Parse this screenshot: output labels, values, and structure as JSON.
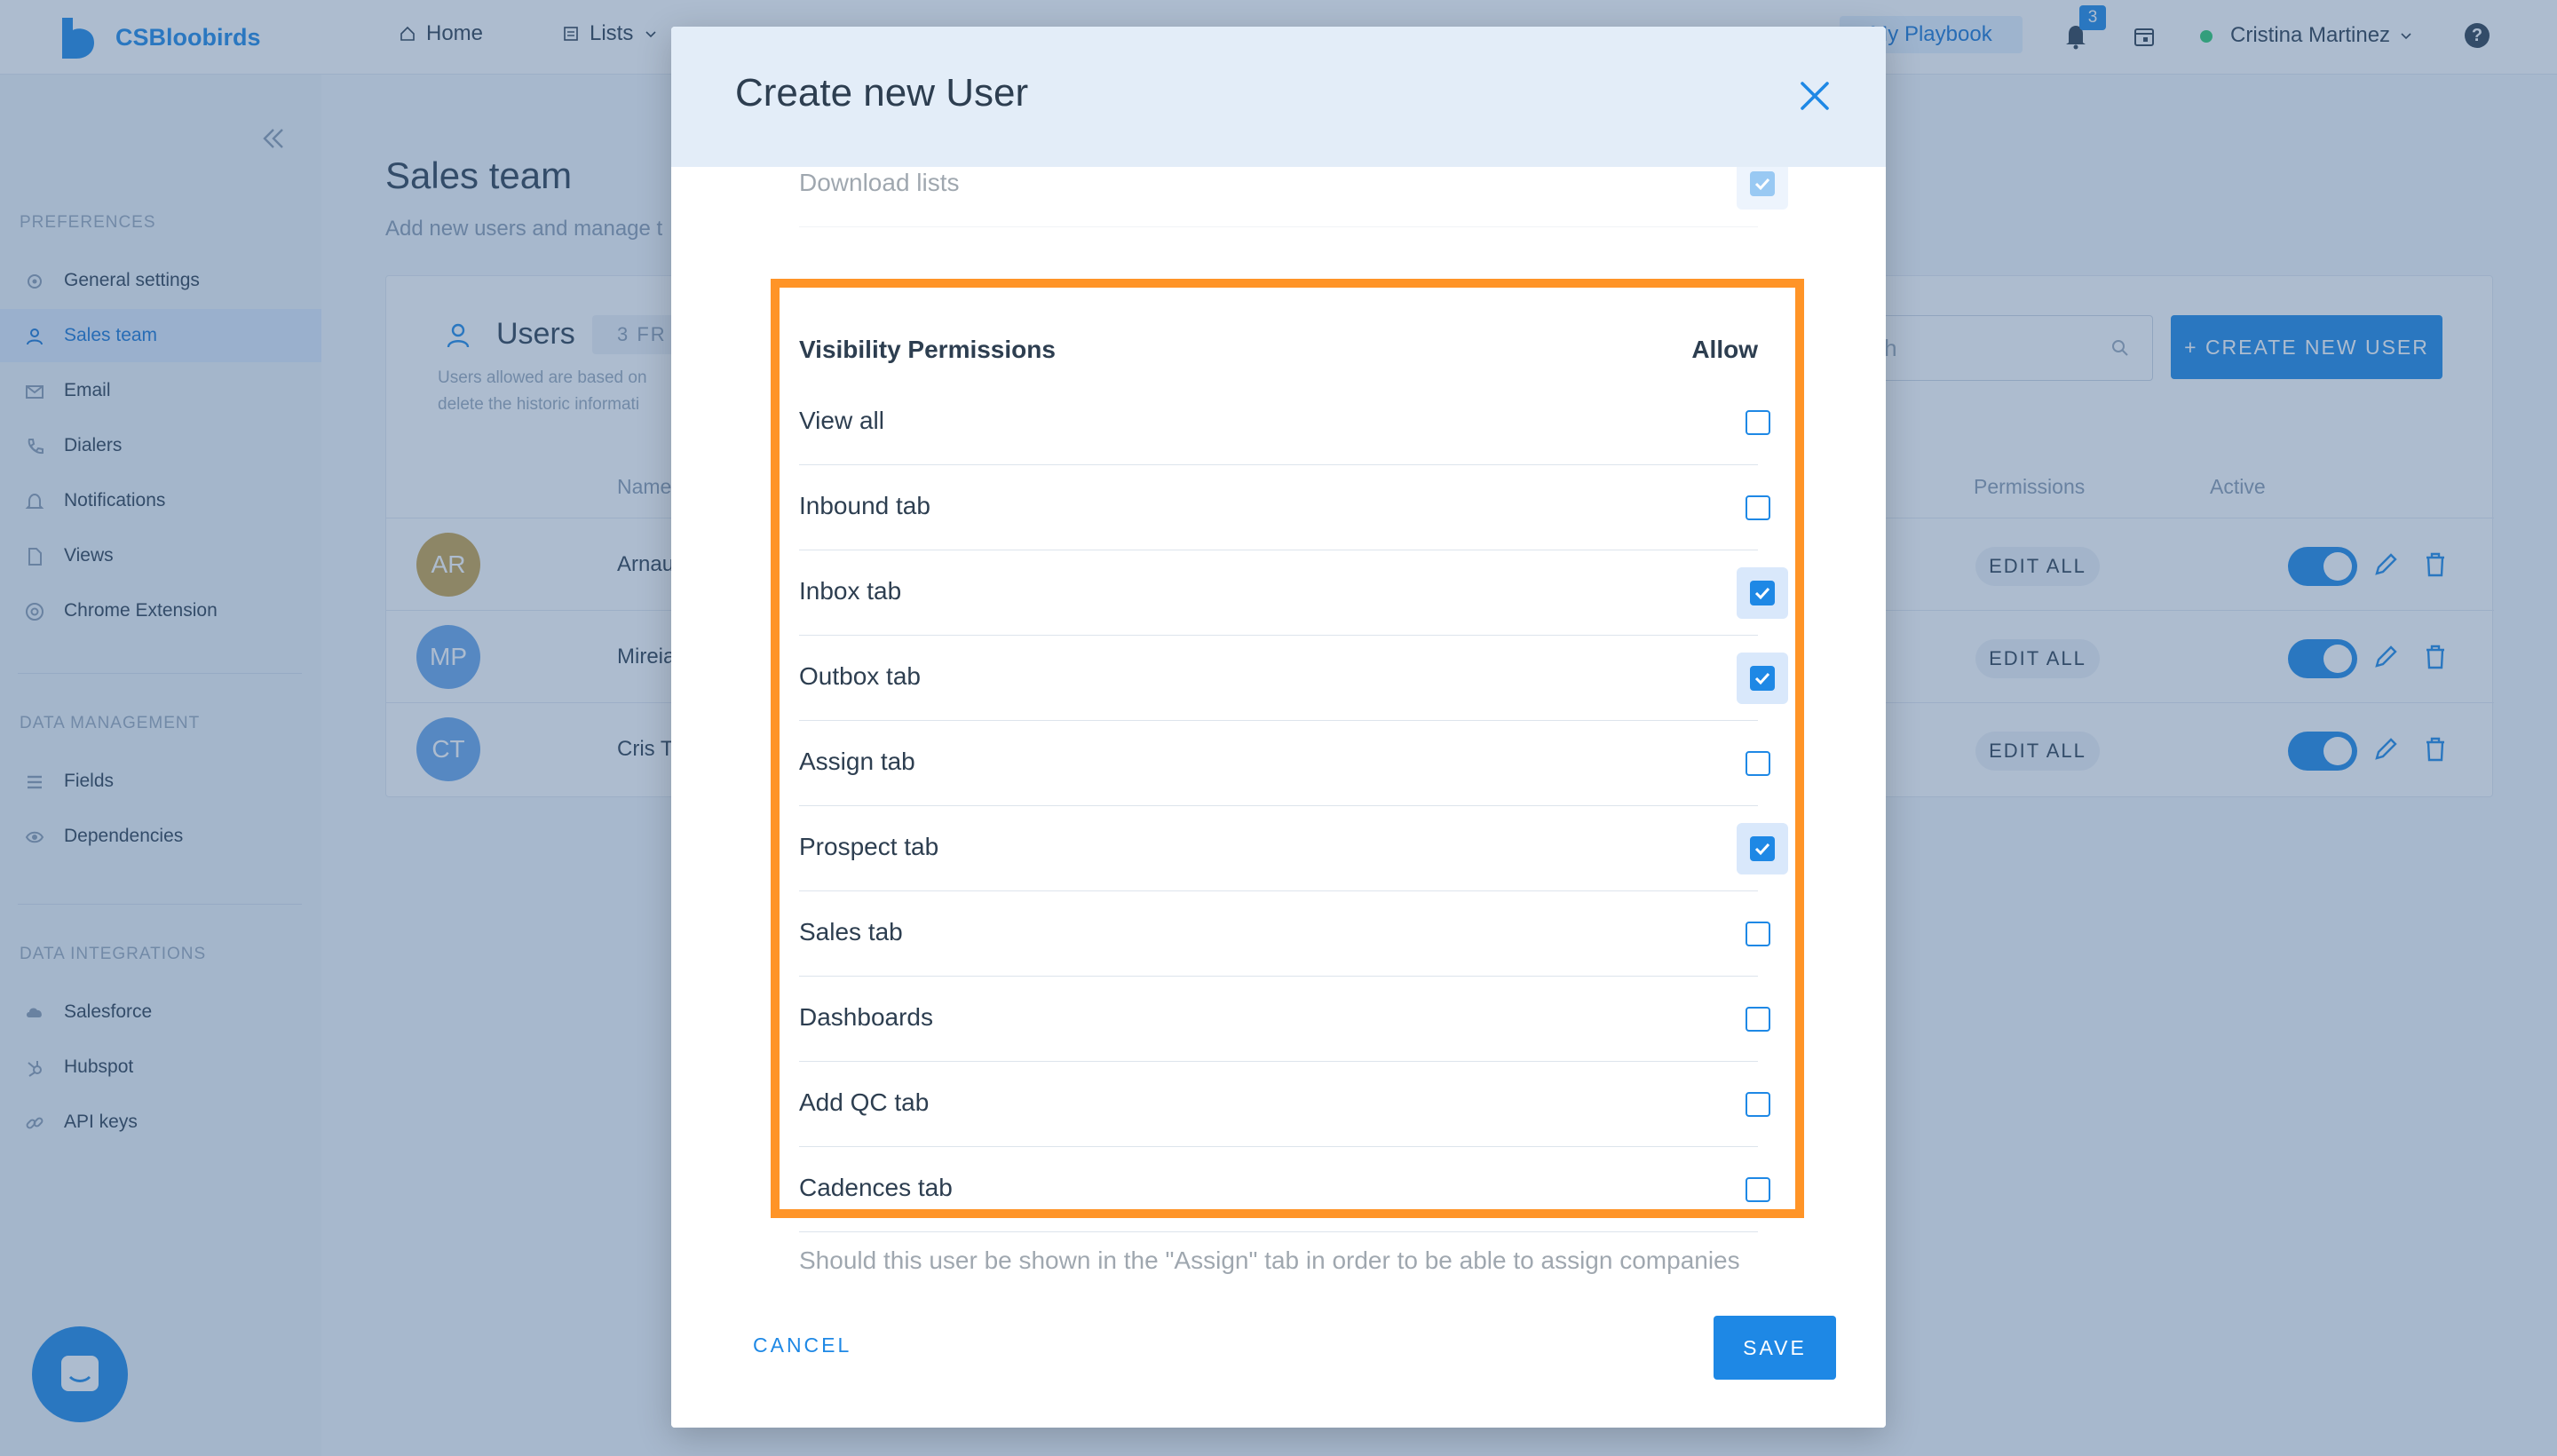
{
  "app": {
    "brand": "CSBloobirds",
    "nav": {
      "home": "Home",
      "lists": "Lists"
    },
    "playbook": "My Playbook",
    "notifications_count": "3",
    "user_name": "Cristina Martinez",
    "help": "?"
  },
  "sidebar": {
    "sections": [
      {
        "title": "PREFERENCES",
        "items": [
          "General settings",
          "Sales team",
          "Email",
          "Dialers",
          "Notifications",
          "Views",
          "Chrome Extension"
        ]
      },
      {
        "title": "DATA MANAGEMENT",
        "items": [
          "Fields",
          "Dependencies"
        ]
      },
      {
        "title": "DATA INTEGRATIONS",
        "items": [
          "Salesforce",
          "Hubspot",
          "API keys"
        ]
      }
    ],
    "active_item": "Sales team"
  },
  "page": {
    "title": "Sales team",
    "subtitle": "Add new users and manage t",
    "users_title": "Users",
    "free_badge": "3 FR",
    "users_note_line1": "Users allowed are based on",
    "users_note_line2": "delete the historic informati",
    "search_placeholder": "arch",
    "create_button": "+ CREATE NEW USER",
    "columns": {
      "name": "Name",
      "permissions": "Permissions",
      "active": "Active"
    },
    "rows": [
      {
        "initials": "AR",
        "name": "Arnau",
        "permissions": "EDIT ALL",
        "avatar_color": "#c8a24a"
      },
      {
        "initials": "MP",
        "name": "Mireia",
        "permissions": "EDIT ALL",
        "avatar_color": "#6aa6e8"
      },
      {
        "initials": "CT",
        "name": "Cris T",
        "permissions": "EDIT ALL",
        "avatar_color": "#6aa6e8"
      }
    ]
  },
  "modal": {
    "title": "Create new User",
    "previous_row": {
      "label": "Download lists",
      "checked": true
    },
    "section_title": "Visibility Permissions",
    "allow_header": "Allow",
    "permissions": [
      {
        "label": "View all",
        "checked": false
      },
      {
        "label": "Inbound tab",
        "checked": false
      },
      {
        "label": "Inbox tab",
        "checked": true
      },
      {
        "label": "Outbox tab",
        "checked": true
      },
      {
        "label": "Assign tab",
        "checked": false
      },
      {
        "label": "Prospect tab",
        "checked": true
      },
      {
        "label": "Sales tab",
        "checked": false
      },
      {
        "label": "Dashboards",
        "checked": false
      },
      {
        "label": "Add QC tab",
        "checked": false
      },
      {
        "label": "Cadences tab",
        "checked": false
      }
    ],
    "assign_question": "Should this user be shown in the \"Assign\" tab in order to be able to assign companies to him/her?",
    "cancel": "CANCEL",
    "save": "SAVE"
  },
  "colors": {
    "accent": "#1e88e5",
    "highlight": "#ff9427"
  }
}
